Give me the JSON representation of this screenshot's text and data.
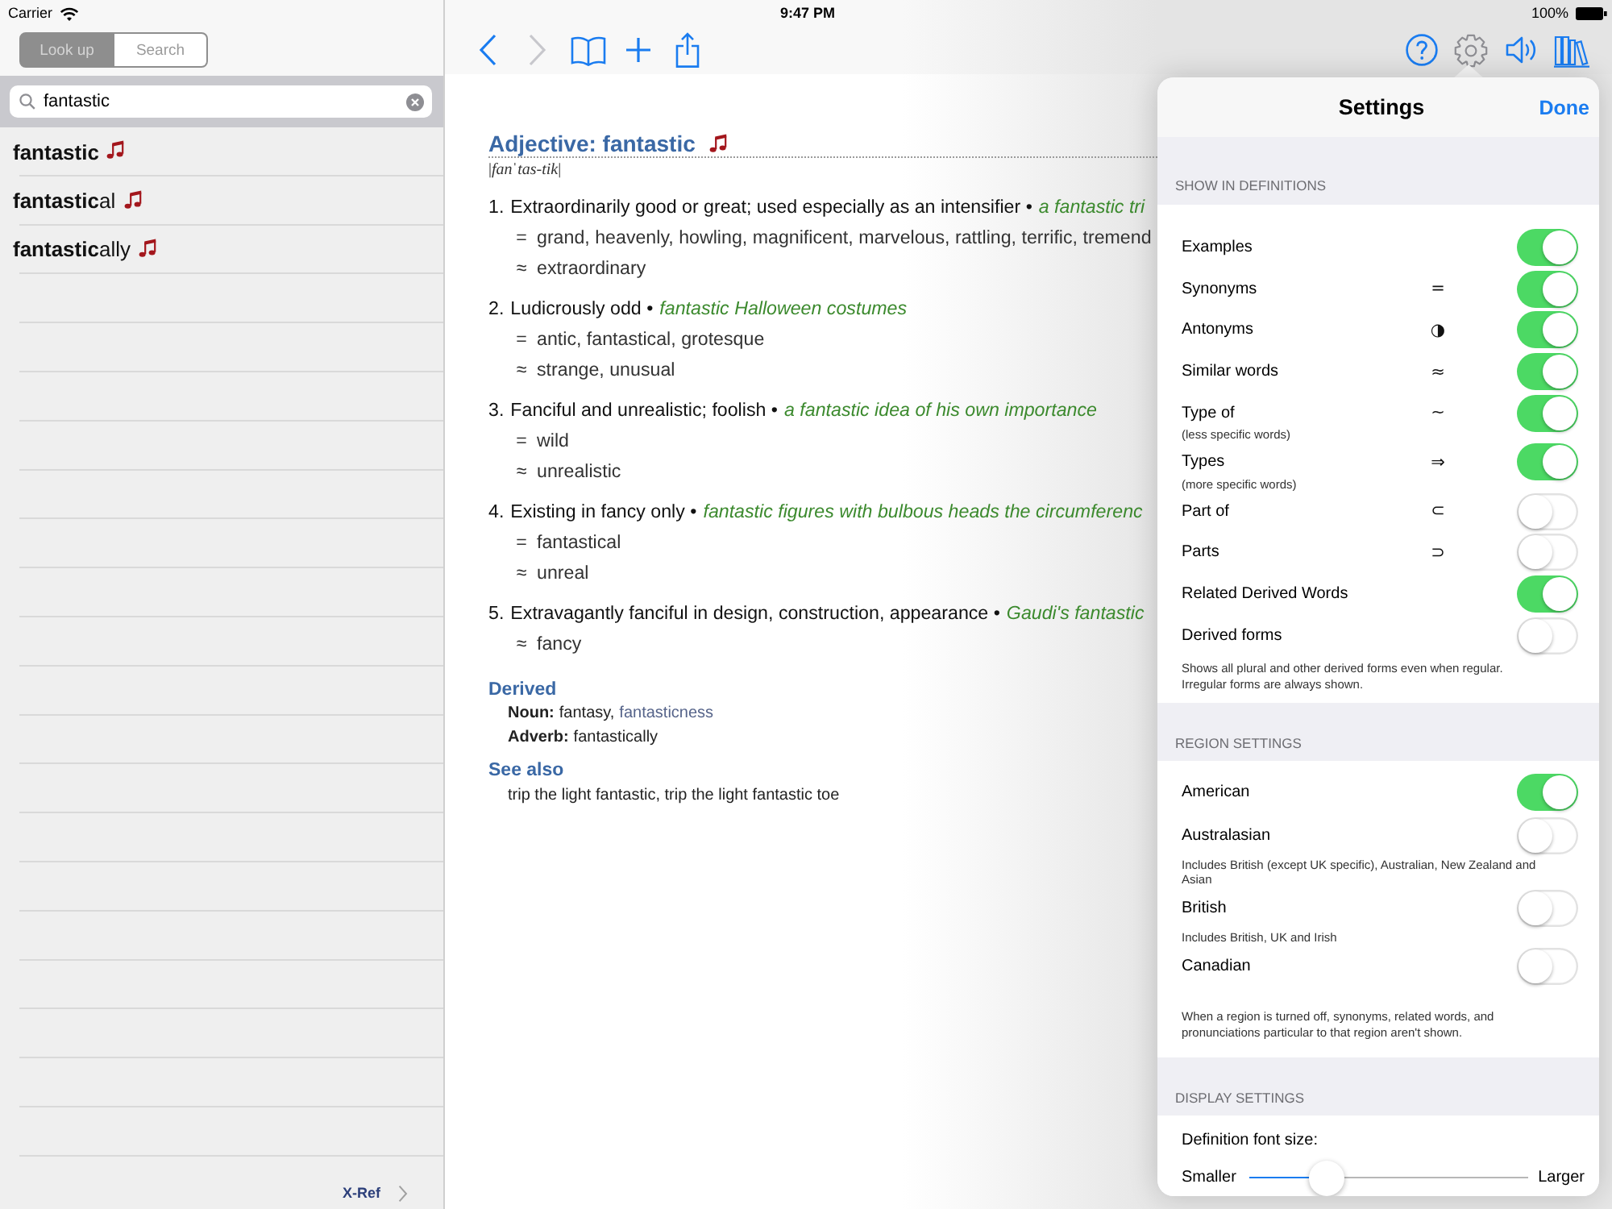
{
  "status_bar": {
    "carrier": "Carrier",
    "time": "9:47 PM",
    "battery": "100%"
  },
  "sidebar": {
    "mode_tabs": [
      {
        "label": "Look up",
        "selected": true
      },
      {
        "label": "Search",
        "selected": false
      }
    ],
    "search": {
      "value": "fantastic"
    },
    "results": [
      {
        "word": "**fantastic**",
        "selected": false
      },
      {
        "word": "**fantastic**al",
        "selected": false
      },
      {
        "word": "**fantastic**ally",
        "selected": false
      }
    ],
    "footer_link": "X-Ref"
  },
  "toolbar": {
    "left": [
      {
        "kind": "back",
        "disabled": false,
        "selected": false
      },
      {
        "kind": "forward",
        "disabled": true,
        "selected": false
      },
      {
        "kind": "bookmarks",
        "disabled": false,
        "selected": false
      },
      {
        "kind": "add",
        "disabled": false,
        "selected": false
      },
      {
        "kind": "share",
        "disabled": false,
        "selected": false
      }
    ],
    "right": [
      {
        "kind": "help",
        "disabled": false,
        "selected": false
      },
      {
        "kind": "settings",
        "disabled": false,
        "selected": true
      },
      {
        "kind": "speaker",
        "disabled": false,
        "selected": false
      },
      {
        "kind": "library",
        "disabled": false,
        "selected": false
      }
    ]
  },
  "entry": {
    "headword": "Adjective: fantastic",
    "pronunciation": "|*fanˈtas-tik*|",
    "senses": [
      {
        "number": "1.",
        "definition": "Extraordinarily good or great; used especially as an intensifier •",
        "example": "a fantastic tri",
        "relations": [
          {
            "symbol": "=",
            "words": "grand, heavenly, howling, magnificent, marvelous, rattling, terrific, tremend"
          },
          {
            "symbol": "≈",
            "words": "extraordinary"
          }
        ]
      },
      {
        "number": "2.",
        "definition": "Ludicrously odd •",
        "example": "fantastic Halloween costumes",
        "relations": [
          {
            "symbol": "=",
            "words": "antic, fantastical, grotesque"
          },
          {
            "symbol": "≈",
            "words": "strange, unusual"
          }
        ]
      },
      {
        "number": "3.",
        "definition": "Fanciful and unrealistic; foolish •",
        "example": "a fantastic idea of his own importance",
        "relations": [
          {
            "symbol": "=",
            "words": "wild"
          },
          {
            "symbol": "≈",
            "words": "unrealistic"
          }
        ]
      },
      {
        "number": "4.",
        "definition": "Existing in fancy only •",
        "example": "fantastic figures with bulbous heads the circumferenc",
        "relations": [
          {
            "symbol": "=",
            "words": "fantastical"
          },
          {
            "symbol": "≈",
            "words": "unreal"
          }
        ]
      },
      {
        "number": "5.",
        "definition": "Extravagantly fanciful in design, construction, appearance •",
        "example": "Gaudi's fantastic",
        "relations": [
          {
            "symbol": "≈",
            "words": "fancy"
          }
        ]
      }
    ],
    "derived": {
      "title": "Derived",
      "forms": [
        {
          "label": "Noun:",
          "words": [
            {
              "text": "fantasy,",
              "link": false
            },
            {
              "text": "fantasticness",
              "link": true
            }
          ]
        },
        {
          "label": "Adverb:",
          "words": [
            {
              "text": "fantastically",
              "link": false
            }
          ]
        }
      ]
    },
    "see_also": {
      "title": "See also",
      "text": "trip the light fantastic, trip the light fantastic toe"
    }
  },
  "settings": {
    "title": "Settings",
    "done": "Done",
    "sections": [
      {
        "header": "SHOW IN DEFINITIONS",
        "rows": [
          {
            "kind": "toggle",
            "label": "Examples",
            "on": true
          },
          {
            "kind": "toggle",
            "label": "Synonyms",
            "symbol": "=",
            "on": true
          },
          {
            "kind": "toggle",
            "label": "Antonyms",
            "symbol": "◑",
            "on": true
          },
          {
            "kind": "toggle",
            "label": "Similar words",
            "symbol": "≈",
            "on": true
          },
          {
            "kind": "toggle",
            "label": "Type of",
            "sublabel": "(less specific words)",
            "symbol": "~",
            "on": true
          },
          {
            "kind": "toggle",
            "label": "Types",
            "sublabel": "(more specific words)",
            "symbol": "⇒",
            "on": true
          },
          {
            "kind": "toggle",
            "label": "Part of",
            "symbol": "⊂",
            "on": false
          },
          {
            "kind": "toggle",
            "label": "Parts",
            "symbol": "⊃",
            "on": false
          },
          {
            "kind": "toggle",
            "label": "Related Derived Words",
            "on": true
          },
          {
            "kind": "toggle",
            "label": "Derived forms",
            "on": false
          }
        ],
        "footer": "Shows all plural and other derived forms even when regular. Irregular forms are always shown."
      },
      {
        "header": "REGION SETTINGS",
        "rows": [
          {
            "kind": "toggle",
            "label": "American",
            "on": true
          },
          {
            "kind": "toggle",
            "label": "Australasian",
            "note": "Includes British (except UK specific), Australian, New Zealand and Asian",
            "on": false
          },
          {
            "kind": "toggle",
            "label": "British",
            "note": "Includes British, UK and Irish",
            "on": false
          },
          {
            "kind": "toggle",
            "label": "Canadian",
            "on": false
          }
        ],
        "footer": "When a region is turned off, synonyms, related words, and pronunciations particular to that region aren't shown."
      },
      {
        "header": "DISPLAY SETTINGS",
        "rows": [
          {
            "kind": "slider",
            "label": "Definition font size:",
            "min_label": "Smaller",
            "max_label": "Larger",
            "level": 0.28
          }
        ]
      }
    ]
  }
}
